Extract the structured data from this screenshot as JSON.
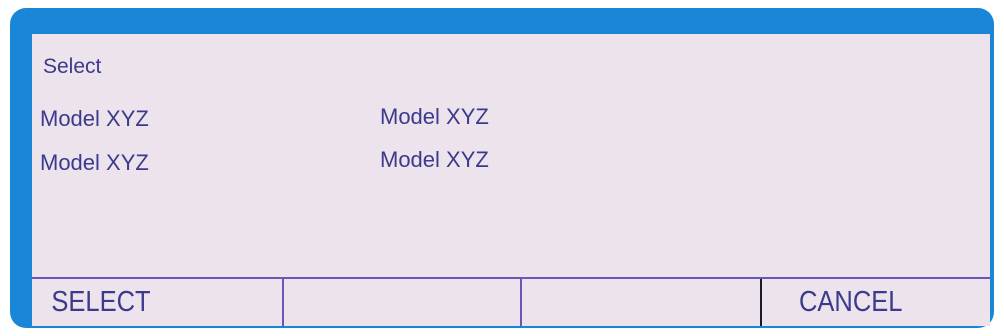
{
  "dialog": {
    "title": "Select",
    "items": [
      {
        "label": "Model XYZ"
      },
      {
        "label": "Model XYZ"
      },
      {
        "label": "Model XYZ"
      },
      {
        "label": "Model XYZ"
      }
    ]
  },
  "softkeys": [
    {
      "label": "SELECT"
    },
    {
      "label": ""
    },
    {
      "label": ""
    },
    {
      "label": "CANCEL"
    }
  ],
  "colors": {
    "bezel": "#1a86d8",
    "screen_background": "#ece3ec",
    "text": "#3b3a8c",
    "divider": "#6a56b6"
  }
}
